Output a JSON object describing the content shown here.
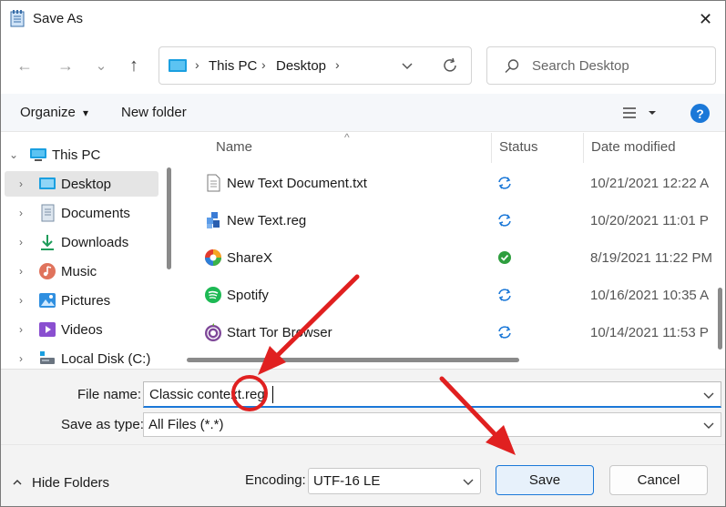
{
  "window": {
    "title": "Save As",
    "close_glyph": "✕"
  },
  "nav": {
    "back_glyph": "←",
    "forward_glyph": "→",
    "recent_glyph": "⌄",
    "up_glyph": "↑"
  },
  "address": {
    "crumbs": [
      "This PC",
      "Desktop"
    ],
    "separator": "›"
  },
  "search": {
    "placeholder": "Search Desktop"
  },
  "toolbar": {
    "organize_label": "Organize",
    "organize_caret": "▾",
    "new_folder_label": "New folder",
    "help_label": "?"
  },
  "sidebar": {
    "items": [
      {
        "label": "This PC",
        "icon": "monitor-icon",
        "expanded": true
      },
      {
        "label": "Desktop",
        "icon": "desktop-icon",
        "selected": true
      },
      {
        "label": "Documents",
        "icon": "documents-icon"
      },
      {
        "label": "Downloads",
        "icon": "downloads-icon"
      },
      {
        "label": "Music",
        "icon": "music-icon"
      },
      {
        "label": "Pictures",
        "icon": "pictures-icon"
      },
      {
        "label": "Videos",
        "icon": "videos-icon"
      },
      {
        "label": "Local Disk (C:)",
        "icon": "disk-icon"
      }
    ]
  },
  "file_list": {
    "columns": [
      "Name",
      "Status",
      "Date modified"
    ],
    "rows": [
      {
        "name": "New Text Document.txt",
        "icon": "text-file-icon",
        "status": "sync-icon",
        "date": "10/21/2021 12:22 A"
      },
      {
        "name": "New Text.reg",
        "icon": "registry-file-icon",
        "status": "sync-icon",
        "date": "10/20/2021 11:01 P"
      },
      {
        "name": "ShareX",
        "icon": "sharex-icon",
        "status": "synced-check-icon",
        "date": "8/19/2021 11:22 PM"
      },
      {
        "name": "Spotify",
        "icon": "spotify-icon",
        "status": "sync-icon",
        "date": "10/16/2021 10:35 A"
      },
      {
        "name": "Start Tor Browser",
        "icon": "tor-browser-icon",
        "status": "sync-icon",
        "date": "10/14/2021 11:53 P"
      }
    ]
  },
  "form": {
    "file_name_label": "File name:",
    "file_name_value": "Classic context.reg",
    "save_type_label": "Save as type:",
    "save_type_value": "All Files  (*.*)"
  },
  "footer": {
    "hide_folders_label": "Hide Folders",
    "hide_folders_chevron": "^",
    "encoding_label": "Encoding:",
    "encoding_value": "UTF-16 LE",
    "save_label": "Save",
    "cancel_label": "Cancel"
  },
  "colors": {
    "accent": "#1b78d8",
    "annotation_red": "#e02020",
    "sync_blue": "#1b78d8",
    "synced_green": "#2e9e3e"
  }
}
